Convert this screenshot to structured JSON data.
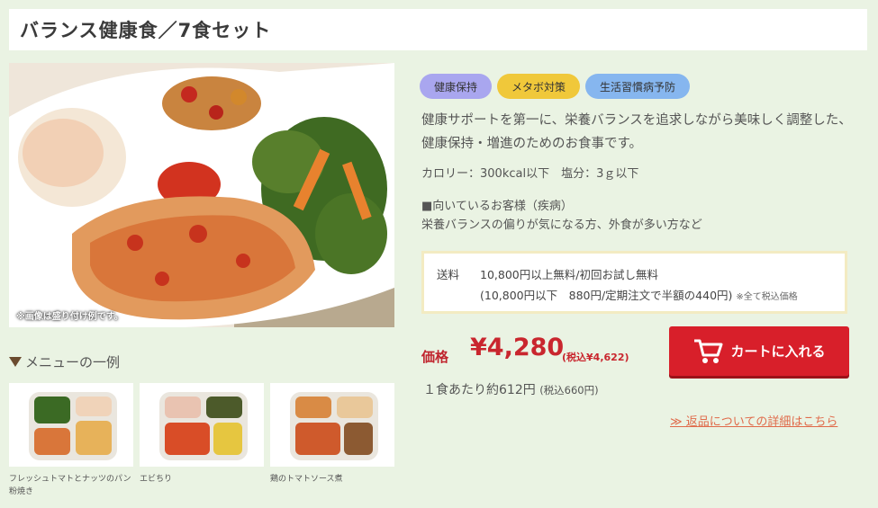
{
  "page": {
    "title": "バランス健康食／7食セット"
  },
  "hero": {
    "note": "※画像は盛り付け例です。"
  },
  "menu": {
    "heading": "メニューの一例",
    "items": [
      {
        "caption": "フレッシュトマトとナッツのパン粉焼き"
      },
      {
        "caption": "エビちり"
      },
      {
        "caption": "鶏のトマトソース煮"
      }
    ]
  },
  "tags": [
    {
      "label": "健康保持",
      "color": "#a9a6ef"
    },
    {
      "label": "メタボ対策",
      "color": "#f0c83a"
    },
    {
      "label": "生活習慣病予防",
      "color": "#86b6ef"
    }
  ],
  "description": "健康サポートを第一に、栄養バランスを追求しながら美味しく調整した、健康保持・増進のためのお食事です。",
  "nutrition": "カロリー：300kcal以下　塩分：3ｇ以下",
  "target": {
    "heading": "■向いているお客様（疾病）",
    "text": "栄養バランスの偏りが気になる方、外食が多い方など"
  },
  "shipping": {
    "label": "送料",
    "line1": "10,800円以上無料/初回お試し無料",
    "line2": "(10,800円以下　880円/定期注文で半額の440円)",
    "note": "※全て税込価格"
  },
  "price": {
    "label": "価格",
    "value": "¥4,280",
    "tax": "(税込¥4,622)",
    "per_meal": "１食あたり約612円",
    "per_meal_tax": "(税込660円)"
  },
  "cart": {
    "label": "カートに入れる",
    "color": "#d81f2a"
  },
  "return_link": "≫ 返品についての詳細はこちら"
}
